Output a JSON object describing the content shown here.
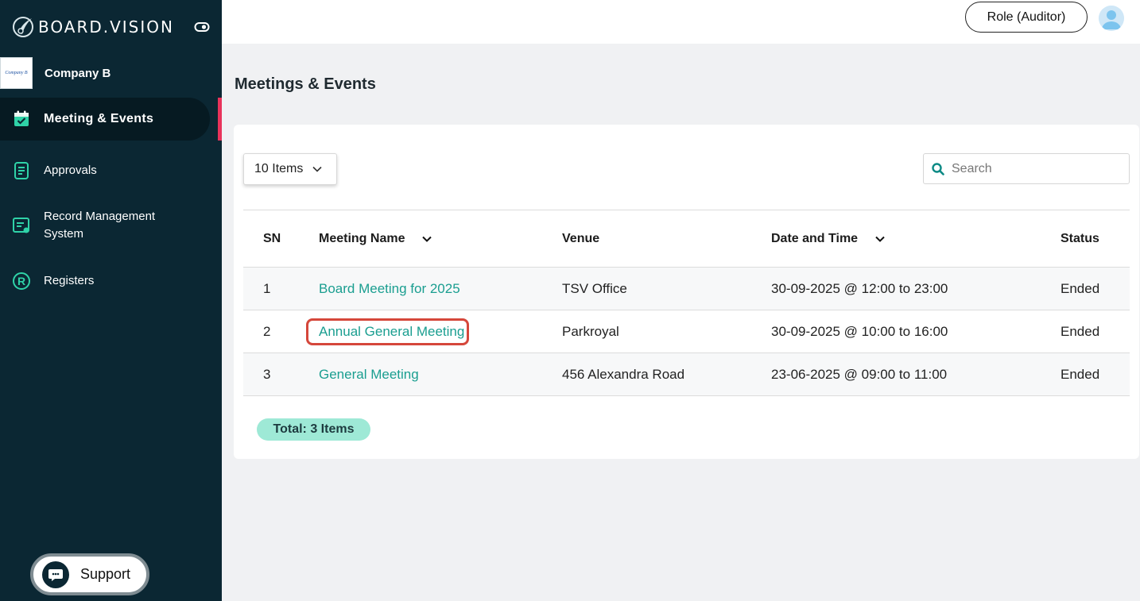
{
  "brand": {
    "name": "BOARD.VISION"
  },
  "sidebar": {
    "company": {
      "logo_text": "Company B",
      "name": "Company B"
    },
    "items": [
      {
        "label": "Meeting & Events",
        "icon": "calendar-check-icon",
        "active": true
      },
      {
        "label": "Approvals",
        "icon": "document-list-icon",
        "active": false
      },
      {
        "label": "Record Management System",
        "icon": "record-screen-icon",
        "active": false
      },
      {
        "label": "Registers",
        "icon": "registered-r-icon",
        "active": false
      }
    ],
    "support_label": "Support"
  },
  "header": {
    "role_label": "Role (Auditor)"
  },
  "page": {
    "title": "Meetings & Events"
  },
  "controls": {
    "items_per_page": "10 Items",
    "search_placeholder": "Search"
  },
  "table": {
    "columns": [
      "SN",
      "Meeting Name",
      "Venue",
      "Date and Time",
      "Status"
    ],
    "rows": [
      {
        "sn": "1",
        "name": "Board Meeting for 2025",
        "venue": "TSV Office",
        "datetime": "30-09-2025 @ 12:00 to 23:00",
        "status": "Ended"
      },
      {
        "sn": "2",
        "name": "Annual General Meeting",
        "venue": "Parkroyal",
        "datetime": "30-09-2025 @ 10:00 to 16:00",
        "status": "Ended"
      },
      {
        "sn": "3",
        "name": "General Meeting",
        "venue": "456 Alexandra Road",
        "datetime": "23-06-2025 @ 09:00 to 11:00",
        "status": "Ended"
      }
    ]
  },
  "footer": {
    "total": "Total: 3 Items"
  },
  "colors": {
    "sidebar_bg": "#0b2733",
    "accent_teal": "#1a9e90",
    "active_marker": "#e8335b",
    "highlight": "#d5473b",
    "badge_bg": "#9ee9d6"
  }
}
